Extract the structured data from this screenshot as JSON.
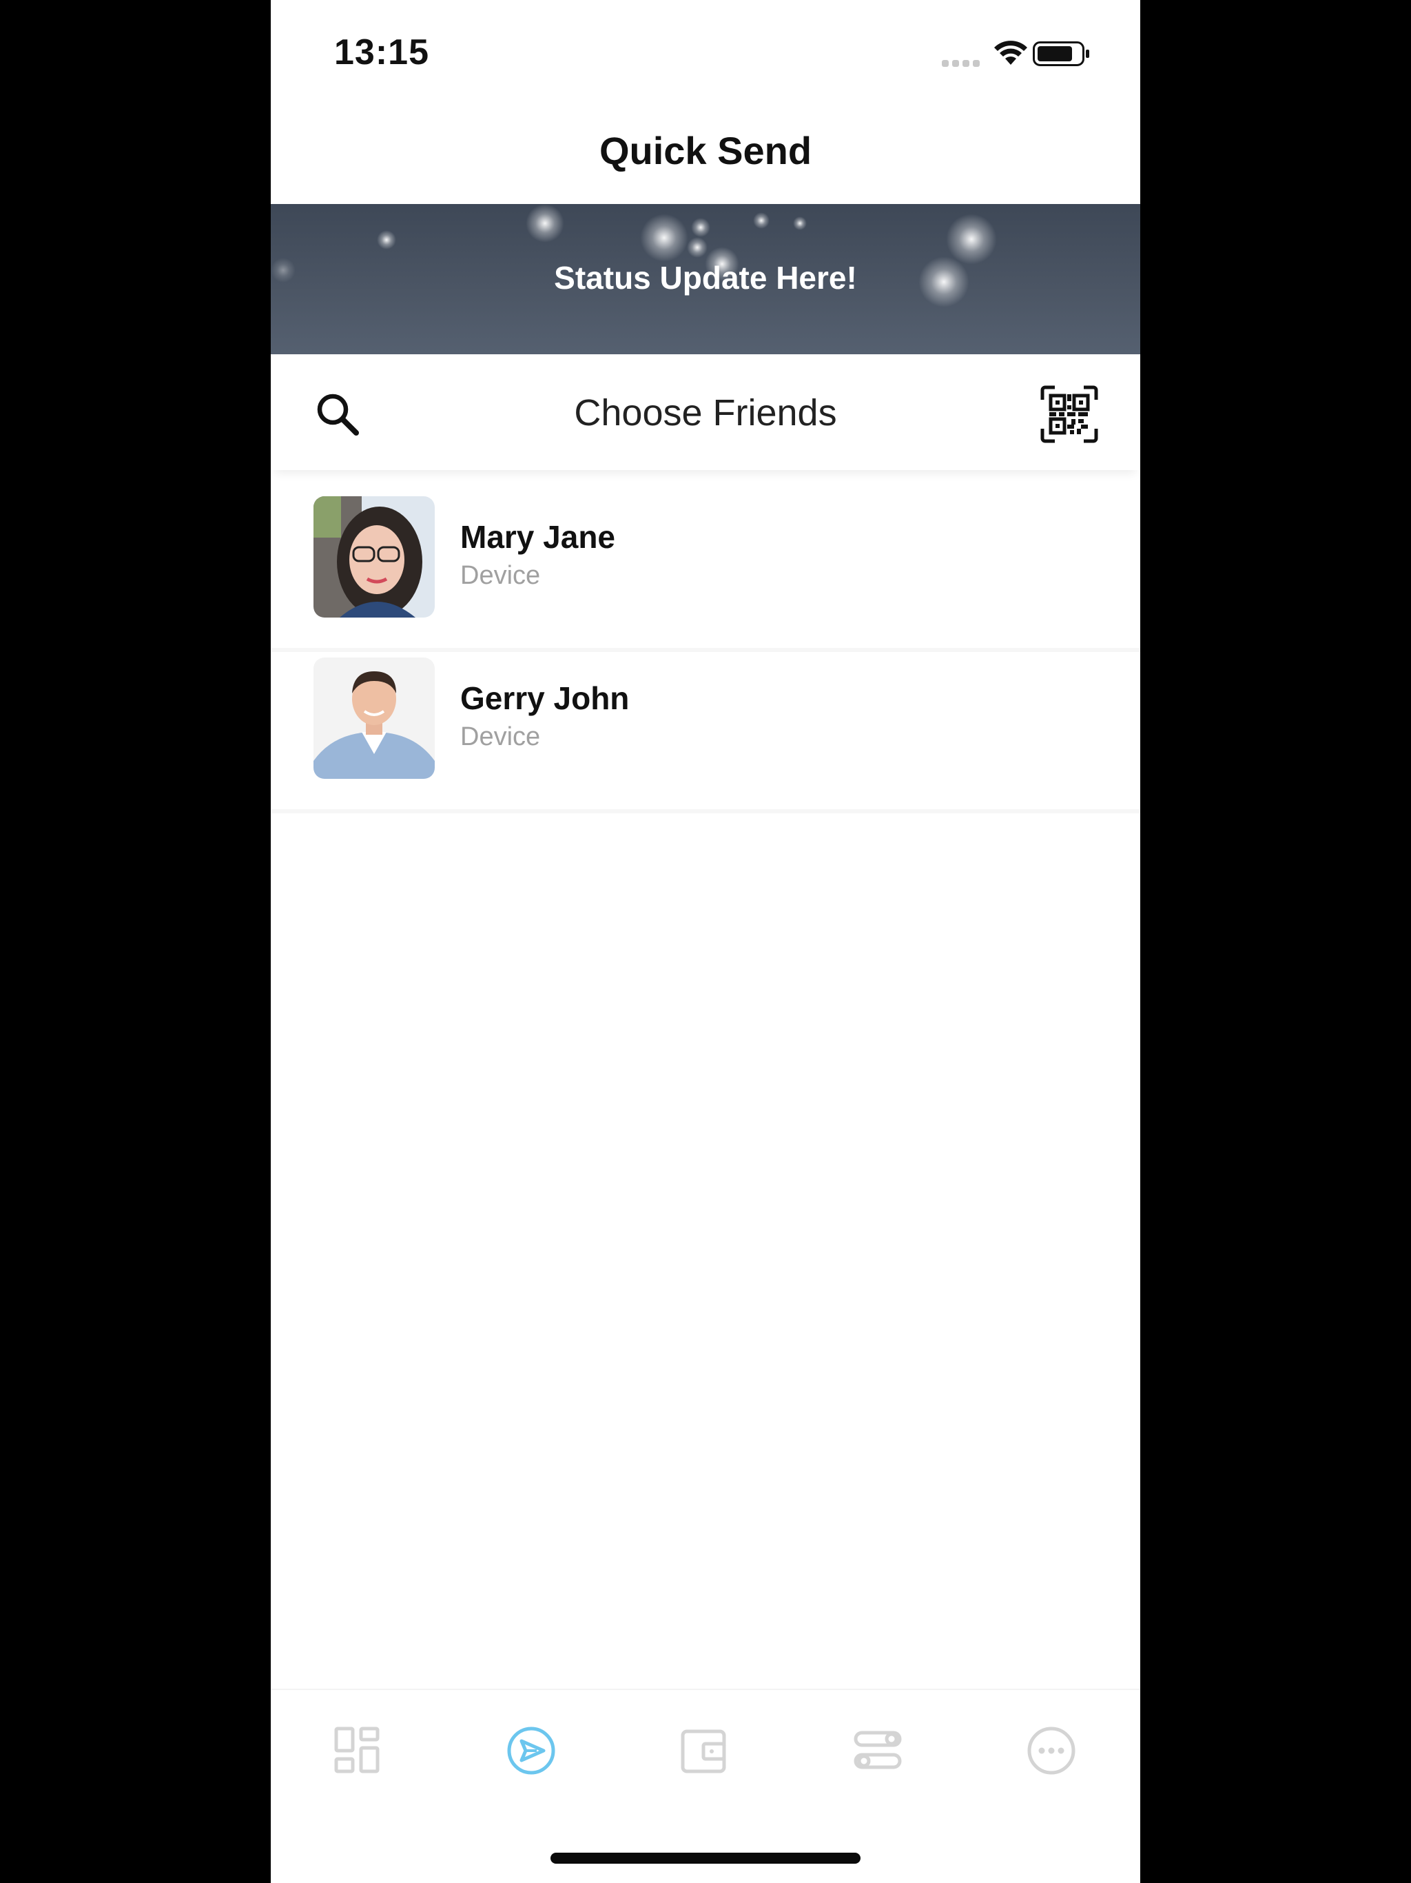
{
  "status_bar": {
    "time": "13:15"
  },
  "nav": {
    "title": "Quick Send"
  },
  "banner": {
    "text": "Status Update Here!"
  },
  "choose_bar": {
    "title": "Choose Friends",
    "search_icon": "search-icon",
    "qr_icon": "qr-code-icon"
  },
  "friends": [
    {
      "name": "Mary Jane",
      "subtitle": "Device"
    },
    {
      "name": "Gerry John",
      "subtitle": "Device"
    }
  ],
  "tab_bar": {
    "items": [
      {
        "icon": "dashboard-icon",
        "active": false
      },
      {
        "icon": "send-icon",
        "active": true
      },
      {
        "icon": "wallet-icon",
        "active": false
      },
      {
        "icon": "settings-sliders-icon",
        "active": false
      },
      {
        "icon": "more-icon",
        "active": false
      }
    ]
  },
  "colors": {
    "accent": "#6cc6ee",
    "inactive": "#d4d4d4",
    "banner": "#4b5564",
    "subtitle": "#a0a0a0"
  }
}
